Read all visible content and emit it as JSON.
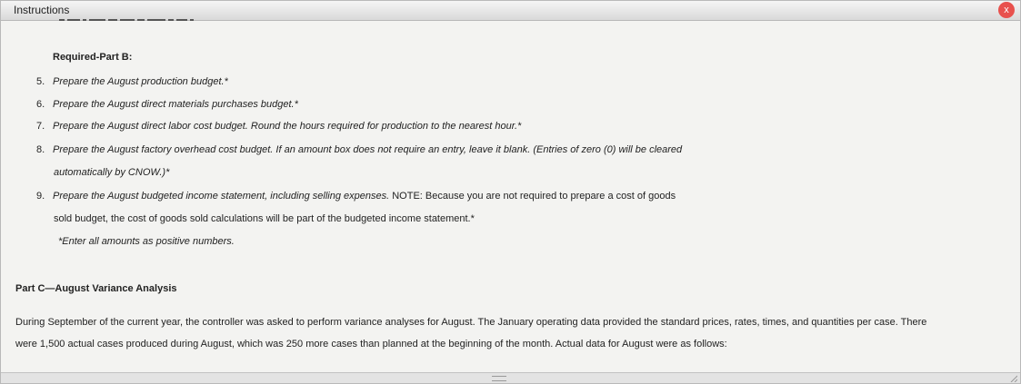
{
  "window": {
    "title": "Instructions",
    "close_label": "x"
  },
  "part_b": {
    "heading": "Required-Part B:",
    "items": [
      {
        "num": "5.",
        "text": "Prepare the August production budget.*"
      },
      {
        "num": "6.",
        "text": "Prepare the August direct materials purchases budget.*"
      },
      {
        "num": "7.",
        "text": "Prepare the August direct labor cost budget. Round the hours required for production to the nearest hour.*"
      },
      {
        "num": "8.",
        "text": "Prepare the August factory overhead cost budget. If an amount box does not require an entry, leave it blank. (Entries of zero (0) will be cleared",
        "cont": "automatically by CNOW.)*"
      },
      {
        "num": "9.",
        "text": "Prepare the August budgeted income statement, including selling expenses.",
        "text_plain": " NOTE: Because you are not required to prepare a cost of goods",
        "cont": "sold budget, the cost of goods sold calculations will be part of the budgeted income statement.*"
      }
    ],
    "note": "*Enter all amounts as positive numbers."
  },
  "part_c": {
    "heading": "Part C—August Variance Analysis",
    "para_line1": "During September of the current year, the controller was asked to perform variance analyses for August. The January operating data provided the standard prices, rates, times, and quantities per case. There",
    "para_line2": "were 1,500 actual cases produced during August, which was 250 more cases than planned at the beginning of the month. Actual data for August were as follows:"
  }
}
